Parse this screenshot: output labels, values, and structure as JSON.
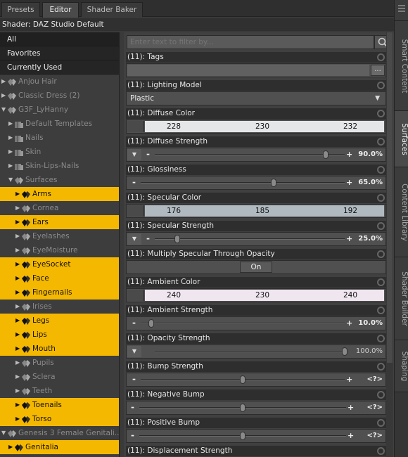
{
  "tabs": [
    "Presets",
    "Editor",
    "Shader Baker"
  ],
  "shader": "Shader: DAZ Studio Default",
  "filters": [
    "All",
    "Favorites",
    "Currently Used"
  ],
  "tree": [
    {
      "label": "Anjou Hair",
      "indent": 0,
      "arrow": "right",
      "hl": false,
      "tone": "dim"
    },
    {
      "label": "Classic Dress (2)",
      "indent": 0,
      "arrow": "right",
      "hl": false,
      "tone": "dim"
    },
    {
      "label": "G3F_LyHanny",
      "indent": 0,
      "arrow": "down",
      "hl": false,
      "tone": "dim"
    },
    {
      "label": "Default Templates",
      "indent": 1,
      "arrow": "right",
      "hl": false,
      "tone": "dim",
      "folder": true
    },
    {
      "label": "Nails",
      "indent": 1,
      "arrow": "right",
      "hl": false,
      "tone": "dim",
      "folder": true
    },
    {
      "label": "Skin",
      "indent": 1,
      "arrow": "right",
      "hl": false,
      "tone": "dim",
      "folder": true
    },
    {
      "label": "Skin-Lips-Nails",
      "indent": 1,
      "arrow": "right",
      "hl": false,
      "tone": "dim",
      "folder": true
    },
    {
      "label": "Surfaces",
      "indent": 1,
      "arrow": "down",
      "hl": false,
      "tone": "dim"
    },
    {
      "label": "Arms",
      "indent": 2,
      "arrow": "right",
      "hl": true
    },
    {
      "label": "Cornea",
      "indent": 2,
      "arrow": "right",
      "hl": false,
      "tone": "dim"
    },
    {
      "label": "Ears",
      "indent": 2,
      "arrow": "right",
      "hl": true
    },
    {
      "label": "Eyelashes",
      "indent": 2,
      "arrow": "right",
      "hl": false,
      "tone": "dim"
    },
    {
      "label": "EyeMoisture",
      "indent": 2,
      "arrow": "right",
      "hl": false,
      "tone": "dim"
    },
    {
      "label": "EyeSocket",
      "indent": 2,
      "arrow": "right",
      "hl": true
    },
    {
      "label": "Face",
      "indent": 2,
      "arrow": "right",
      "hl": true
    },
    {
      "label": "Fingernails",
      "indent": 2,
      "arrow": "right",
      "hl": true
    },
    {
      "label": "Irises",
      "indent": 2,
      "arrow": "right",
      "hl": false,
      "tone": "dim"
    },
    {
      "label": "Legs",
      "indent": 2,
      "arrow": "right",
      "hl": true
    },
    {
      "label": "Lips",
      "indent": 2,
      "arrow": "right",
      "hl": true
    },
    {
      "label": "Mouth",
      "indent": 2,
      "arrow": "right",
      "hl": true
    },
    {
      "label": "Pupils",
      "indent": 2,
      "arrow": "right",
      "hl": false,
      "tone": "dim"
    },
    {
      "label": "Sclera",
      "indent": 2,
      "arrow": "right",
      "hl": false,
      "tone": "dim"
    },
    {
      "label": "Teeth",
      "indent": 2,
      "arrow": "right",
      "hl": false,
      "tone": "dim"
    },
    {
      "label": "Toenails",
      "indent": 2,
      "arrow": "right",
      "hl": true
    },
    {
      "label": "Torso",
      "indent": 2,
      "arrow": "right",
      "hl": true
    },
    {
      "label": "Genesis 3 Female Genitali...",
      "indent": 0,
      "arrow": "down",
      "hl": false,
      "tone": "dim"
    },
    {
      "label": "Genitalia",
      "indent": 1,
      "arrow": "right",
      "hl": true
    }
  ],
  "filter_placeholder": "Enter text to filter by...",
  "params": [
    {
      "label": "(11): Tags",
      "kind": "text",
      "button": "..."
    },
    {
      "label": "(11): Lighting Model",
      "kind": "combo",
      "value": "Plastic"
    },
    {
      "label": "(11): Diffuse Color",
      "kind": "color",
      "rgb": [
        228,
        230,
        232
      ],
      "bg": "#e4e6e8"
    },
    {
      "label": "(11): Diffuse Strength",
      "kind": "slider",
      "dropdown": true,
      "pos": 0.9,
      "value": "90.0%"
    },
    {
      "label": "(11): Glossiness",
      "kind": "slider",
      "dropdown": false,
      "pos": 0.65,
      "value": "65.0%"
    },
    {
      "label": "(11): Specular Color",
      "kind": "color",
      "rgb": [
        176,
        185,
        192
      ],
      "bg": "#b0b9c0"
    },
    {
      "label": "(11): Specular Strength",
      "kind": "slider",
      "dropdown": true,
      "pos": 0.25,
      "value": "25.0%",
      "ctrl_pos": 0.12
    },
    {
      "label": "(11): Multiply Specular Through Opacity",
      "kind": "toggle",
      "value": "On"
    },
    {
      "label": "(11): Ambient Color",
      "kind": "color",
      "rgb": [
        240,
        230,
        240
      ],
      "bg": "#f0e6f0"
    },
    {
      "label": "(11): Ambient Strength",
      "kind": "slider",
      "dropdown": false,
      "pos": 0.1,
      "value": "10.0%",
      "ctrl_pos": 0.05
    },
    {
      "label": "(11): Opacity Strength",
      "kind": "slider",
      "dropdown": true,
      "pos": 1.0,
      "value": "100.0%",
      "plain": true,
      "nominus": true,
      "noplus": true
    },
    {
      "label": "(11): Bump Strength",
      "kind": "slider",
      "dropdown": false,
      "pos": 0.5,
      "value": "<?>"
    },
    {
      "label": "(11): Negative Bump",
      "kind": "slider",
      "dropdown": false,
      "pos": 0.5,
      "value": "<?>",
      "wide": true
    },
    {
      "label": "(11): Positive Bump",
      "kind": "slider",
      "dropdown": false,
      "pos": 0.5,
      "value": "<?>",
      "wide": true
    },
    {
      "label": "(11): Displacement Strength",
      "kind": "header"
    }
  ],
  "dock": [
    "Smart Content",
    "Surfaces",
    "Content Library",
    "Shader Builder",
    "Shaping"
  ],
  "colors": {
    "highlight": "#f5b800",
    "panel": "#404040"
  }
}
